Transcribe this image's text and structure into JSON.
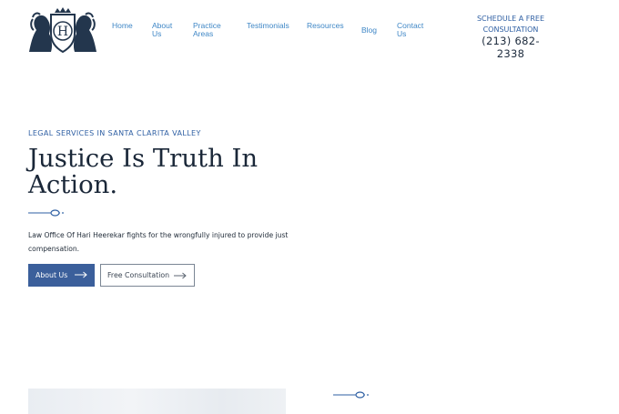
{
  "header": {
    "logo": {
      "monogram": "H",
      "icon": "lion-crest-logo-icon"
    },
    "nav": [
      {
        "label": "Home"
      },
      {
        "label": "About Us"
      },
      {
        "label": "Practice Areas"
      },
      {
        "label": "Testimonials"
      },
      {
        "label": "Resources"
      },
      {
        "label": "Blog"
      },
      {
        "label": "Contact Us"
      }
    ],
    "cta": {
      "schedule_label": "SCHEDULE A FREE CONSULTATION",
      "phone": "(213) 682-2338"
    }
  },
  "hero": {
    "eyebrow": "LEGAL SERVICES IN SANTA CLARITA VALLEY",
    "title": "Justice Is Truth In Action.",
    "description": "Law Office Of Hari Heerekar fights for the wrongfully injured to provide just compensation.",
    "buttons": {
      "primary": "About Us",
      "secondary": "Free Consultation"
    }
  },
  "colors": {
    "accent": "#2e5fa3",
    "nav_link": "#3f87c6",
    "button_fill": "#3b5f9b",
    "heading": "#1a2738"
  }
}
